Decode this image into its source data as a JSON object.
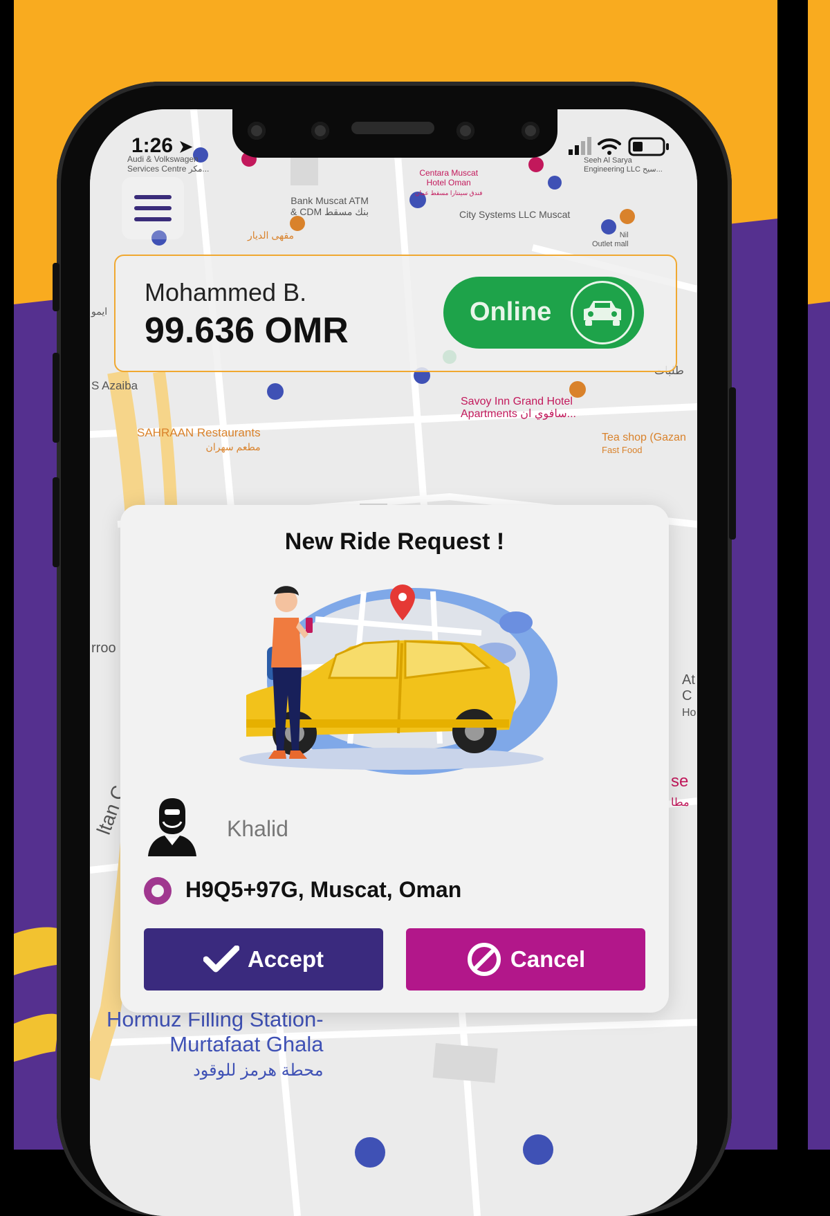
{
  "colors": {
    "orange": "#f9ab1f",
    "purple": "#55308f",
    "online_green": "#1ea34a",
    "accept": "#3a2a7e",
    "cancel": "#b2178a",
    "card_border": "#f0a830"
  },
  "status_bar": {
    "time": "1:26"
  },
  "map_labels": {
    "audi": "Audi & Volkswagen",
    "audi2": "Services Centre مكر...",
    "bank": "Bank Muscat ATM",
    "bank2": "& CDM بنك مسقط",
    "centara": "Centara Muscat",
    "centara2": "Hotel Oman",
    "centara3": "فندق سينتارا مسقط عمان",
    "city_systems": "City Systems LLC Muscat",
    "seeh": "Seeh Al Sarya",
    "seeh2": "Engineering LLC سيح...",
    "maqha": "مقهى الديار",
    "nil": "Nil",
    "nil2": "Outlet mall",
    "azaiba": "S Azaiba",
    "savoy": "Savoy Inn Grand Hotel",
    "savoy2": "Apartments سافوي ان...",
    "sahraan": "SAHRAAN Restaurants",
    "sahraan2": "مطعم سهران",
    "tea": "Tea shop (Gazan",
    "tea2": "Fast Food",
    "talabat": "طلبات",
    "hormuz": "Hormuz Filling Station-",
    "hormuz2": "Murtafaat Ghala",
    "hormuz3": "محطة هرمز للوقود",
    "ayumi": "ايمو",
    "rroo": "rroo",
    "ltan": "ltan C",
    "at": "At",
    "c": "C",
    "ho": "Ho",
    "se": "se",
    "mah": "مطا"
  },
  "driver": {
    "name": "Mohammed B.",
    "balance": "99.636 OMR",
    "status_label": "Online"
  },
  "ride_request": {
    "title": "New Ride Request !",
    "rider_name": "Khalid",
    "pickup": "H9Q5+97G, Muscat, Oman",
    "accept_label": "Accept",
    "cancel_label": "Cancel"
  },
  "icons": {
    "menu": "hamburger-menu-icon",
    "car": "car-icon",
    "rider": "rider-avatar-icon",
    "location": "location-dot-icon",
    "check": "check-icon",
    "cancel": "prohibited-icon"
  }
}
